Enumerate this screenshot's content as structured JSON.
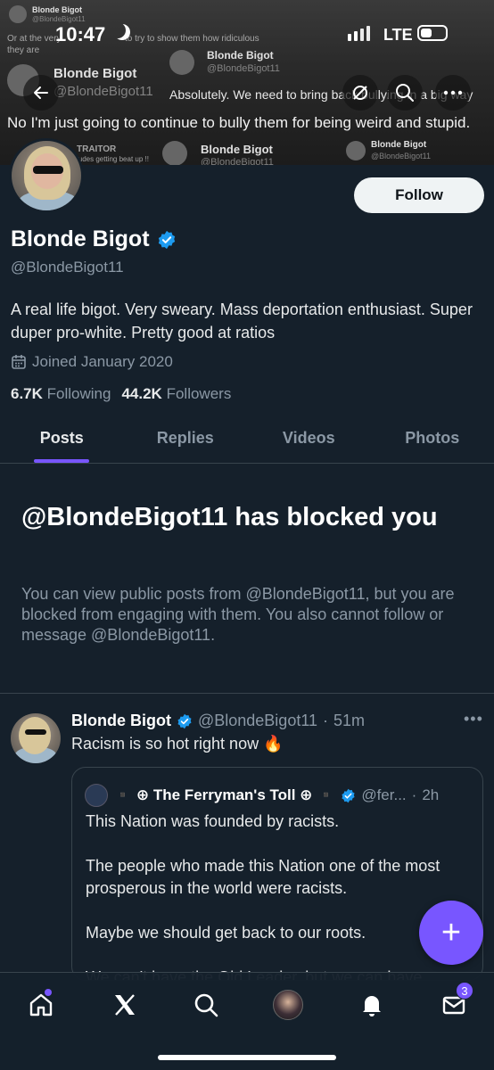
{
  "status_bar": {
    "time": "10:47",
    "network": "LTE"
  },
  "banner": {
    "header_label": "Blonde Bigot",
    "header_handle": "@BlondeBigot11",
    "faint_text_1": "Or at the very",
    "faint_text_2": "to try to show them how ridiculous",
    "faint_text_3": "they are",
    "name_1": "Blonde Bigot",
    "handle_1": "@BlondeBigot11",
    "name_2": "Blonde Bigot",
    "handle_2": "@BlondeBigot11",
    "reply_text": "Absolutely. We need to bring back bullying in a big way",
    "main_quote": "No I'm just going to continue to bully them for being weird and stupid.",
    "traitor_label": "TRAITOR",
    "traitor_sub": "ludes getting beat up !!",
    "name_3": "Blonde Bigot",
    "handle_3": "@BlondeBigot11",
    "name_4": "Blonde Bigot",
    "handle_4": "@BlondeBigot11"
  },
  "profile": {
    "display_name": "Blonde Bigot",
    "handle": "@BlondeBigot11",
    "bio": "A real life bigot. Very sweary. Mass deportation enthusiast. Super duper pro-white. Pretty good at ratios",
    "joined": "Joined January 2020",
    "following_count": "6.7K",
    "following_label": "Following",
    "followers_count": "44.2K",
    "followers_label": "Followers",
    "follow_button": "Follow"
  },
  "tabs": [
    {
      "label": "Posts",
      "active": true
    },
    {
      "label": "Replies",
      "active": false
    },
    {
      "label": "Videos",
      "active": false
    },
    {
      "label": "Photos",
      "active": false
    }
  ],
  "blocked": {
    "title": "@BlondeBigot11 has blocked you",
    "description": "You can view public posts from @BlondeBigot11, but you are blocked from engaging with them. You also cannot follow or message @BlondeBigot11."
  },
  "post": {
    "author": "Blonde Bigot",
    "handle": "@BlondeBigot11",
    "time": "51m",
    "text": "Racism is so hot right now 🔥",
    "more": "•••",
    "quote": {
      "author": "▪️ ⊕ The Ferryman's Toll ⊕ ▪️",
      "handle": "@fer...",
      "time": "2h",
      "paragraph_1": "This Nation was founded by racists.",
      "paragraph_2": "The people who made this Nation one of the most prosperous in the world were racists.",
      "paragraph_3": "Maybe we should get back to our roots.",
      "paragraph_4": "We can't have the Old Leader, but we can have"
    }
  },
  "fab": {
    "label": "+"
  },
  "bottom_nav": {
    "items": [
      "home-icon",
      "x-logo-icon",
      "search-icon",
      "avatar",
      "bell-icon",
      "mail-icon"
    ],
    "mail_badge": "3"
  },
  "colors": {
    "background": "#15202b",
    "accent": "#7856ff",
    "verified": "#1d9bf0",
    "muted": "#8b98a5"
  }
}
